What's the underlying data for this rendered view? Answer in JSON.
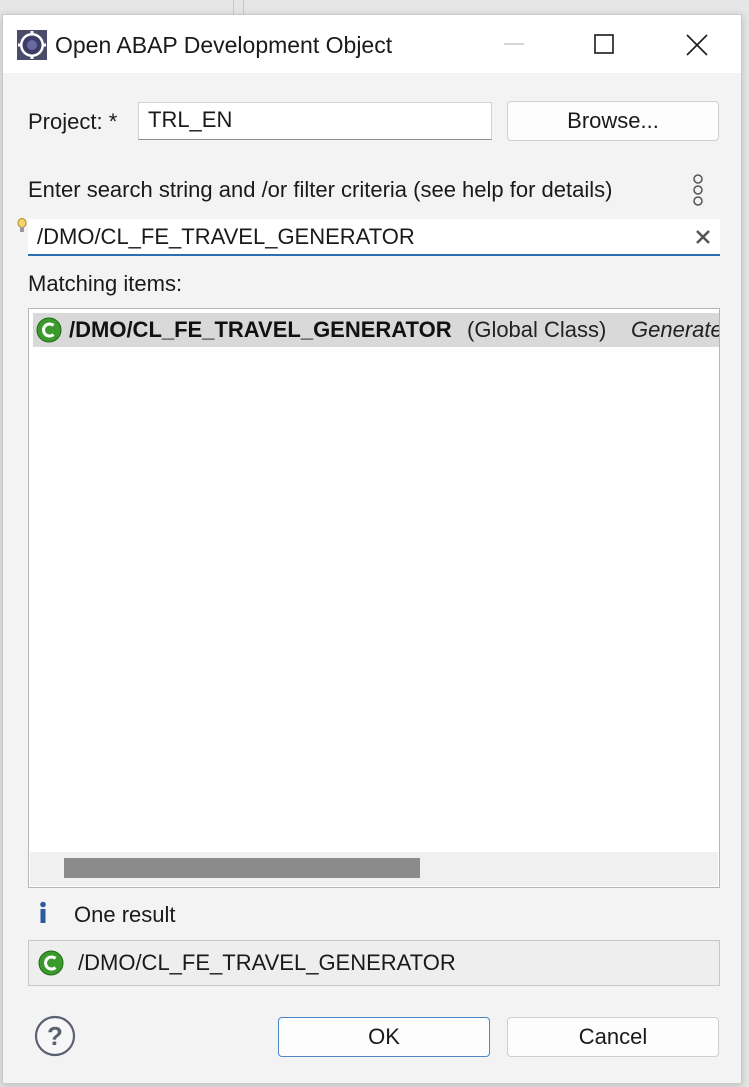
{
  "dialog": {
    "title": "Open ABAP Development Object",
    "project_label": "Project: *",
    "project_value": "TRL_EN",
    "browse_label": "Browse...",
    "search_label": "Enter search string and /or filter criteria (see help for details)",
    "search_value": "/DMO/CL_FE_TRAVEL_GENERATOR",
    "matching_label": "Matching items:",
    "items": [
      {
        "name": "/DMO/CL_FE_TRAVEL_GENERATOR",
        "type": "(Global Class)",
        "description": "Generate"
      }
    ],
    "status_text": "One result",
    "selected_value": "/DMO/CL_FE_TRAVEL_GENERATOR",
    "ok_label": "OK",
    "cancel_label": "Cancel"
  },
  "icons": {
    "app": "eclipse-gear-icon",
    "class": "class-c-icon",
    "info": "info-icon",
    "help": "help-question-icon",
    "menu": "vertical-dots-icon",
    "clear": "clear-x-icon",
    "hint": "lightbulb-icon"
  },
  "colors": {
    "accent": "#2a6fb3",
    "class_icon_green": "#3a9a2c",
    "selection": "#d9d9d9",
    "info_blue": "#2c5aa0"
  }
}
